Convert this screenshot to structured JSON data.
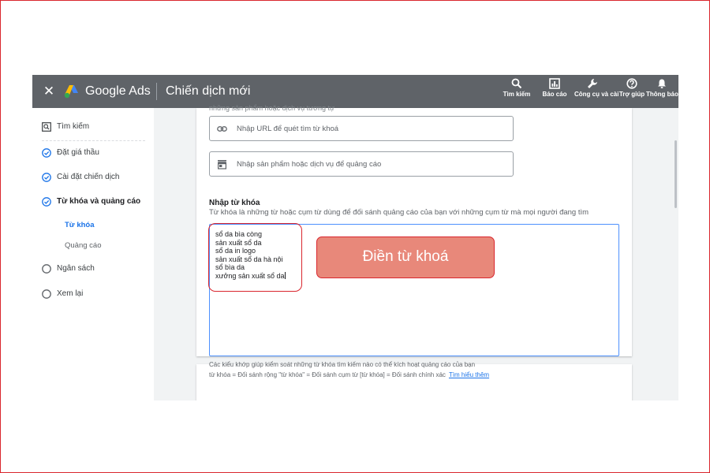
{
  "header": {
    "close_icon": "close-icon",
    "brand": "Google Ads",
    "campaign_title": "Chiến dịch mới",
    "tools": [
      {
        "label": "Tìm kiếm",
        "icon": "search-icon"
      },
      {
        "label": "Báo cáo",
        "icon": "report-icon"
      },
      {
        "label": "Công cụ và cài",
        "icon": "wrench-icon"
      },
      {
        "label": "Trợ giúp",
        "icon": "help-icon"
      },
      {
        "label": "Thông báo",
        "icon": "bell-icon"
      }
    ]
  },
  "sidebar": {
    "items": [
      {
        "label": "Tìm kiếm",
        "icon": "search-box-icon"
      },
      {
        "label": "Đặt giá thầu",
        "icon": "check-circle-icon"
      },
      {
        "label": "Cài đặt chiến dịch",
        "icon": "check-circle-icon"
      },
      {
        "label": "Từ khóa và quảng cáo",
        "icon": "check-circle-icon"
      },
      {
        "label": "Ngân sách",
        "icon": "empty-circle-icon"
      },
      {
        "label": "Xem lại",
        "icon": "empty-circle-icon"
      }
    ],
    "subitems": [
      {
        "label": "Từ khóa",
        "active": true
      },
      {
        "label": "Quảng cáo",
        "active": false
      }
    ]
  },
  "main": {
    "cut_text": "những sản phẩm hoặc dịch vụ tương tự",
    "url_field_placeholder": "Nhập URL để quét tìm từ khoá",
    "product_field_placeholder": "Nhập sản phẩm hoặc dịch vụ để quảng cáo",
    "section_title": "Nhập từ khóa",
    "section_desc": "Từ khóa là những từ hoặc cụm từ dùng để đối sánh quảng cáo của bạn với những cụm từ mà mọi người đang tìm",
    "keywords": [
      "sổ da bìa còng",
      "sản xuất sổ da",
      "sổ da in logo",
      "sản xuất sổ da hà nội",
      "sổ bìa da",
      "xưởng sản xuất sổ da"
    ],
    "help_line1": "Các kiểu khớp giúp kiểm soát những từ khóa tìm kiếm nào có thể kích hoạt quảng cáo của bạn",
    "help_line2": "từ khóa = Đối sánh rộng   \"từ khóa\" = Đối sánh cụm từ   [từ khóa] = Đối sánh chính xác",
    "help_link": "Tìm hiểu thêm"
  },
  "annotation": {
    "callout_text": "Điền từ khoá"
  },
  "colors": {
    "topbar": "#5f6368",
    "accent": "#1a73e8",
    "annotation_border": "#d9262e",
    "callout_fill": "#e8887a"
  }
}
